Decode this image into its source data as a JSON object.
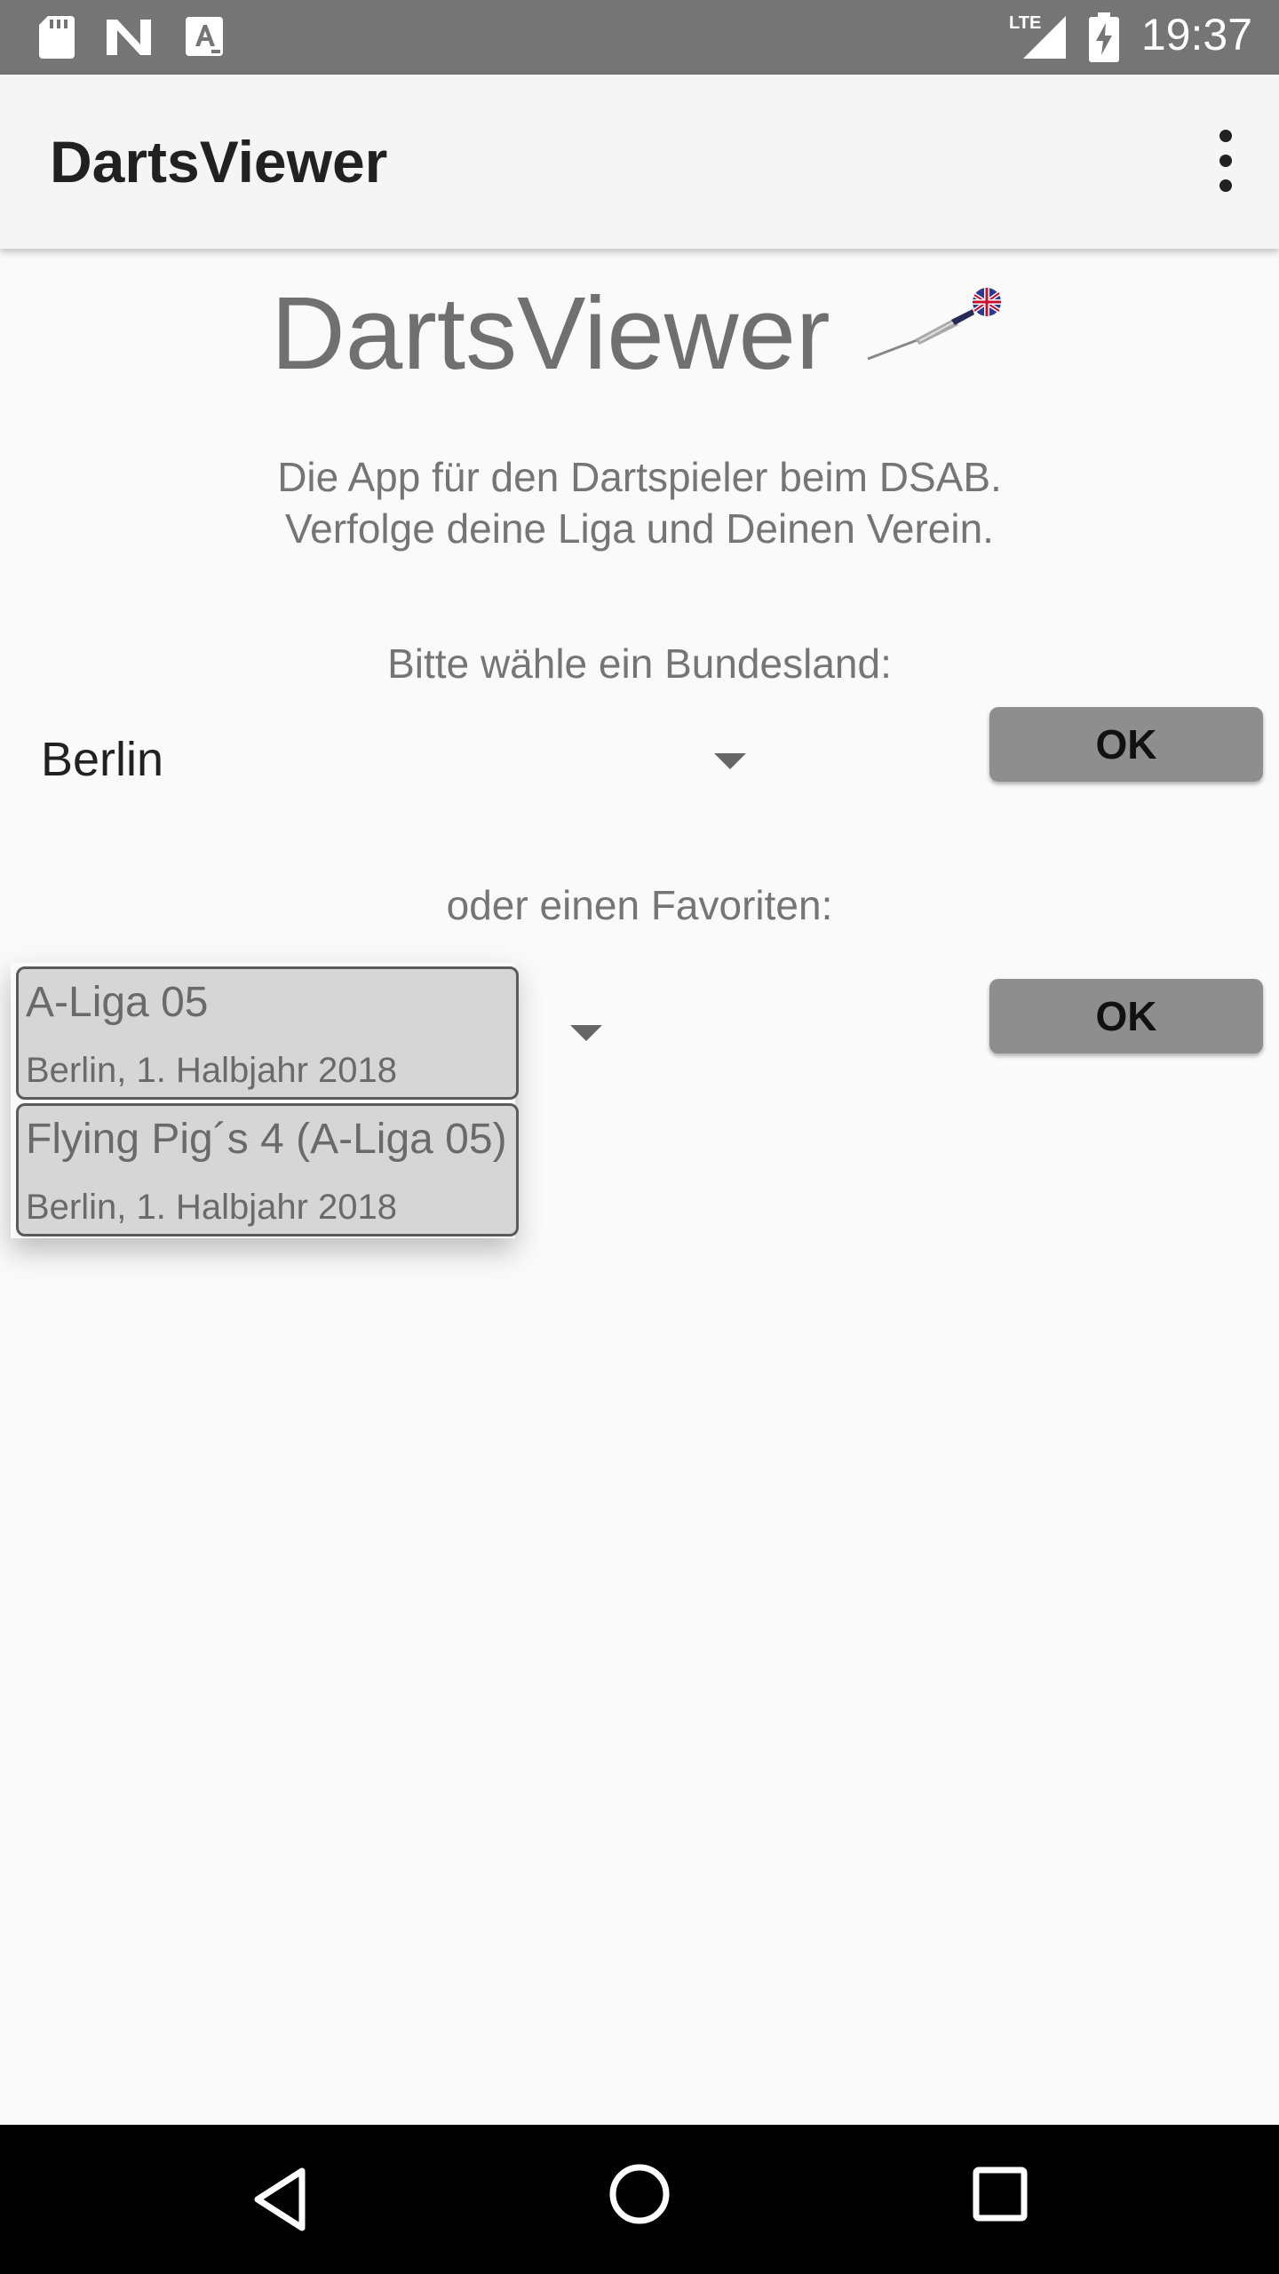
{
  "status_bar": {
    "time": "19:37",
    "network": "LTE",
    "icons": [
      "sd-card-icon",
      "n-notification-icon",
      "a-notification-icon",
      "lte-signal-icon",
      "battery-charging-icon"
    ]
  },
  "app_bar": {
    "title": "DartsViewer",
    "menu_icon": "more-vert-icon"
  },
  "header": {
    "title": "DartsViewer",
    "logo_icon": "dart-icon"
  },
  "intro": {
    "line1": "Die App für den Dartspieler beim DSAB.",
    "line2": "Verfolge deine Liga und Deinen Verein."
  },
  "state_section": {
    "label": "Bitte wähle ein Bundesland:",
    "selected": "Berlin",
    "ok_label": "OK"
  },
  "favorite_section": {
    "label": "oder einen Favoriten:",
    "ok_label": "OK",
    "options": [
      {
        "name": "A-Liga 05",
        "subtitle": "Berlin, 1. Halbjahr 2018"
      },
      {
        "name": "Flying Pig´s 4 (A-Liga 05)",
        "subtitle": "Berlin, 1. Halbjahr 2018"
      }
    ]
  },
  "nav_bar": {
    "back_icon": "back-icon",
    "home_icon": "home-icon",
    "recents_icon": "recents-icon"
  },
  "colors": {
    "status_bar": "#757575",
    "app_bar": "#f5f5f5",
    "background": "#fafafa",
    "button": "#8e8e8e",
    "dropdown_item": "#d6d6d6",
    "nav_bar": "#000000"
  }
}
